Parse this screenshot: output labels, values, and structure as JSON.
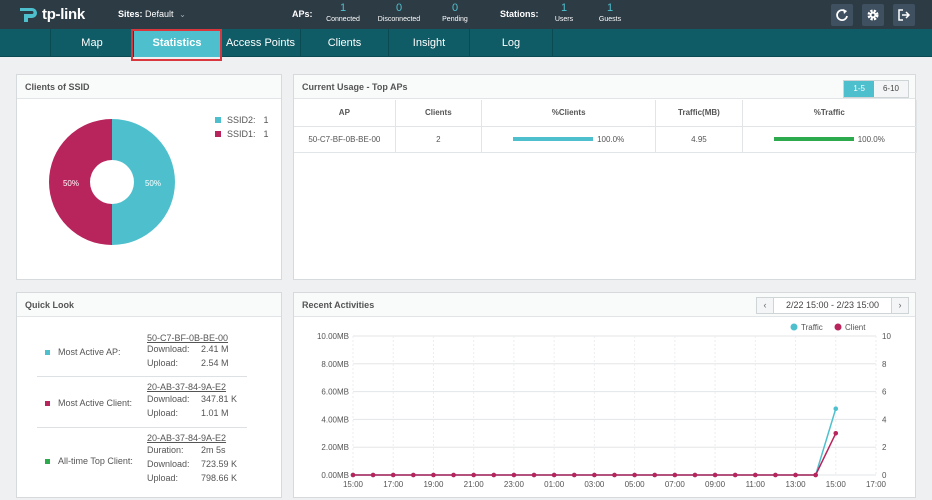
{
  "header": {
    "brand": "tp-link",
    "sites_label": "Sites:",
    "sites_value": "Default",
    "aps_label": "APs:",
    "aps": [
      {
        "num": "1",
        "cap": "Connected"
      },
      {
        "num": "0",
        "cap": "Disconnected"
      },
      {
        "num": "0",
        "cap": "Pending"
      }
    ],
    "stations_label": "Stations:",
    "stations": [
      {
        "num": "1",
        "cap": "Users"
      },
      {
        "num": "1",
        "cap": "Guests"
      }
    ],
    "icons": [
      "refresh-icon",
      "gear-icon",
      "logout-icon"
    ]
  },
  "nav": {
    "tabs": [
      "Map",
      "Statistics",
      "Access Points",
      "Clients",
      "Insight",
      "Log"
    ],
    "active": "Statistics"
  },
  "clients_ssid": {
    "title": "Clients of SSID",
    "legend": [
      {
        "label": "SSID2:",
        "value": "1",
        "color": "#4ec0cd"
      },
      {
        "label": "SSID1:",
        "value": "1",
        "color": "#b8245c"
      }
    ],
    "slices": [
      {
        "label": "50%",
        "value": 50,
        "color": "#4ec0cd"
      },
      {
        "label": "50%",
        "value": 50,
        "color": "#b8245c"
      }
    ]
  },
  "top_aps": {
    "title": "Current Usage - Top APs",
    "pager": [
      "1-5",
      "6-10"
    ],
    "columns": [
      "AP",
      "Clients",
      "%Clients",
      "Traffic(MB)",
      "%Traffic"
    ],
    "rows": [
      {
        "ap": "50-C7-BF-0B-BE-00",
        "clients": "2",
        "pct_clients": "100.0%",
        "pct_clients_value": 100,
        "traffic": "4.95",
        "pct_traffic": "100.0%",
        "pct_traffic_value": 100
      }
    ],
    "bar_colors": {
      "clients": "#4ec0cd",
      "traffic": "#2eaa4e"
    }
  },
  "quick_look": {
    "title": "Quick Look",
    "items": [
      {
        "label": "Most Active AP:",
        "color": "#4ec0cd",
        "mac": "50-C7-BF-0B-BE-00",
        "kv": [
          {
            "k": "Download:",
            "v": "2.41 M"
          },
          {
            "k": "Upload:",
            "v": "2.54 M"
          }
        ]
      },
      {
        "label": "Most Active Client:",
        "color": "#b8245c",
        "mac": "20-AB-37-84-9A-E2",
        "kv": [
          {
            "k": "Download:",
            "v": "347.81 K"
          },
          {
            "k": "Upload:",
            "v": "1.01 M"
          }
        ]
      },
      {
        "label": "All-time Top Client:",
        "color": "#2eaa4e",
        "mac": "20-AB-37-84-9A-E2",
        "kv": [
          {
            "k": "Duration:",
            "v": "2m 5s"
          },
          {
            "k": "Download:",
            "v": "723.59 K"
          },
          {
            "k": "Upload:",
            "v": "798.66 K"
          }
        ]
      }
    ]
  },
  "activities": {
    "title": "Recent Activities",
    "range": "2/22 15:00 - 2/23 15:00",
    "prev_icon": "chevron-left-icon",
    "next_icon": "chevron-right-icon"
  },
  "chart_data": {
    "type": "line",
    "x": [
      "15:00",
      "17:00",
      "19:00",
      "21:00",
      "23:00",
      "01:00",
      "03:00",
      "05:00",
      "07:00",
      "09:00",
      "11:00",
      "13:00",
      "15:00",
      "17:00"
    ],
    "y_left_ticks": [
      "10.00MB",
      "8.00MB",
      "6.00MB",
      "4.00MB",
      "2.00MB",
      "0.00MB"
    ],
    "y_right_ticks": [
      "10",
      "8",
      "6",
      "4",
      "2",
      "0"
    ],
    "ylim_left": [
      0,
      10
    ],
    "ylim_right": [
      0,
      10
    ],
    "grid": true,
    "legend_position": "top-right",
    "series": [
      {
        "name": "Traffic",
        "color": "#4ec0cd",
        "axis": "left",
        "values": [
          0,
          0,
          0,
          0,
          0,
          0,
          0,
          0,
          0,
          0,
          0,
          0,
          0,
          0,
          0,
          0,
          0,
          0,
          0,
          0,
          0,
          0,
          0,
          0,
          4.77
        ]
      },
      {
        "name": "Client",
        "color": "#b8245c",
        "axis": "right",
        "values": [
          0,
          0,
          0,
          0,
          0,
          0,
          0,
          0,
          0,
          0,
          0,
          0,
          0,
          0,
          0,
          0,
          0,
          0,
          0,
          0,
          0,
          0,
          0,
          0,
          3
        ]
      }
    ],
    "points_per_tick": 2
  }
}
